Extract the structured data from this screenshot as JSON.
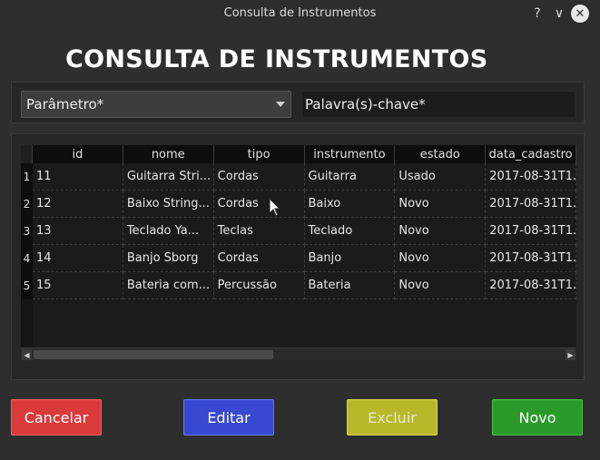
{
  "window": {
    "title": "Consulta de Instrumentos",
    "help_label": "?",
    "minimize_label": "∨",
    "close_label": "✕"
  },
  "heading": "CONSULTA DE INSTRUMENTOS",
  "filter": {
    "parameter_value": "Parâmetro*",
    "keyword_value": "Palavra(s)-chave*"
  },
  "table": {
    "columns": [
      "id",
      "nome",
      "tipo",
      "instrumento",
      "estado",
      "data_cadastro"
    ],
    "rows": [
      {
        "num": "1",
        "cells": [
          "11",
          "Guitarra Stri...",
          "Cordas",
          "Guitarra",
          "Usado",
          "2017-08-31T1..."
        ]
      },
      {
        "num": "2",
        "cells": [
          "12",
          "Baixo String...",
          "Cordas",
          "Baixo",
          "Novo",
          "2017-08-31T1..."
        ]
      },
      {
        "num": "3",
        "cells": [
          "13",
          "Teclado Ya...",
          "Teclas",
          "Teclado",
          "Novo",
          "2017-08-31T1..."
        ]
      },
      {
        "num": "4",
        "cells": [
          "14",
          "Banjo Sborg",
          "Cordas",
          "Banjo",
          "Novo",
          "2017-08-31T1..."
        ]
      },
      {
        "num": "5",
        "cells": [
          "15",
          "Bateria com...",
          "Percussão",
          "Bateria",
          "Novo",
          "2017-08-31T1..."
        ]
      }
    ]
  },
  "buttons": {
    "cancel": "Cancelar",
    "edit": "Editar",
    "delete": "Excluir",
    "new": "Novo"
  },
  "colors": {
    "cancel": "#d93a3a",
    "edit": "#3848d0",
    "delete": "#b8b82a",
    "new": "#2a9a2a"
  }
}
